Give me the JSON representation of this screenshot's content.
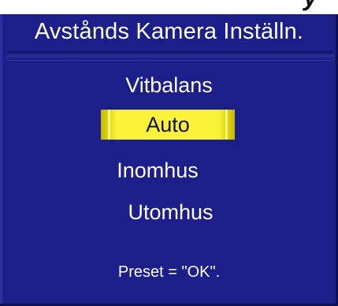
{
  "window": {
    "title": "Avstånds Kamera Inställn."
  },
  "menu": {
    "heading": "Vitbalans",
    "options": [
      {
        "label": "Auto",
        "selected": true
      },
      {
        "label": "Inomhus",
        "selected": false
      },
      {
        "label": "Utomhus",
        "selected": false
      }
    ]
  },
  "footer": {
    "hint": "Preset = \"OK\"."
  },
  "colors": {
    "background": "#1c1f8a",
    "highlight": "#fbf23a",
    "text": "#ffffff"
  }
}
